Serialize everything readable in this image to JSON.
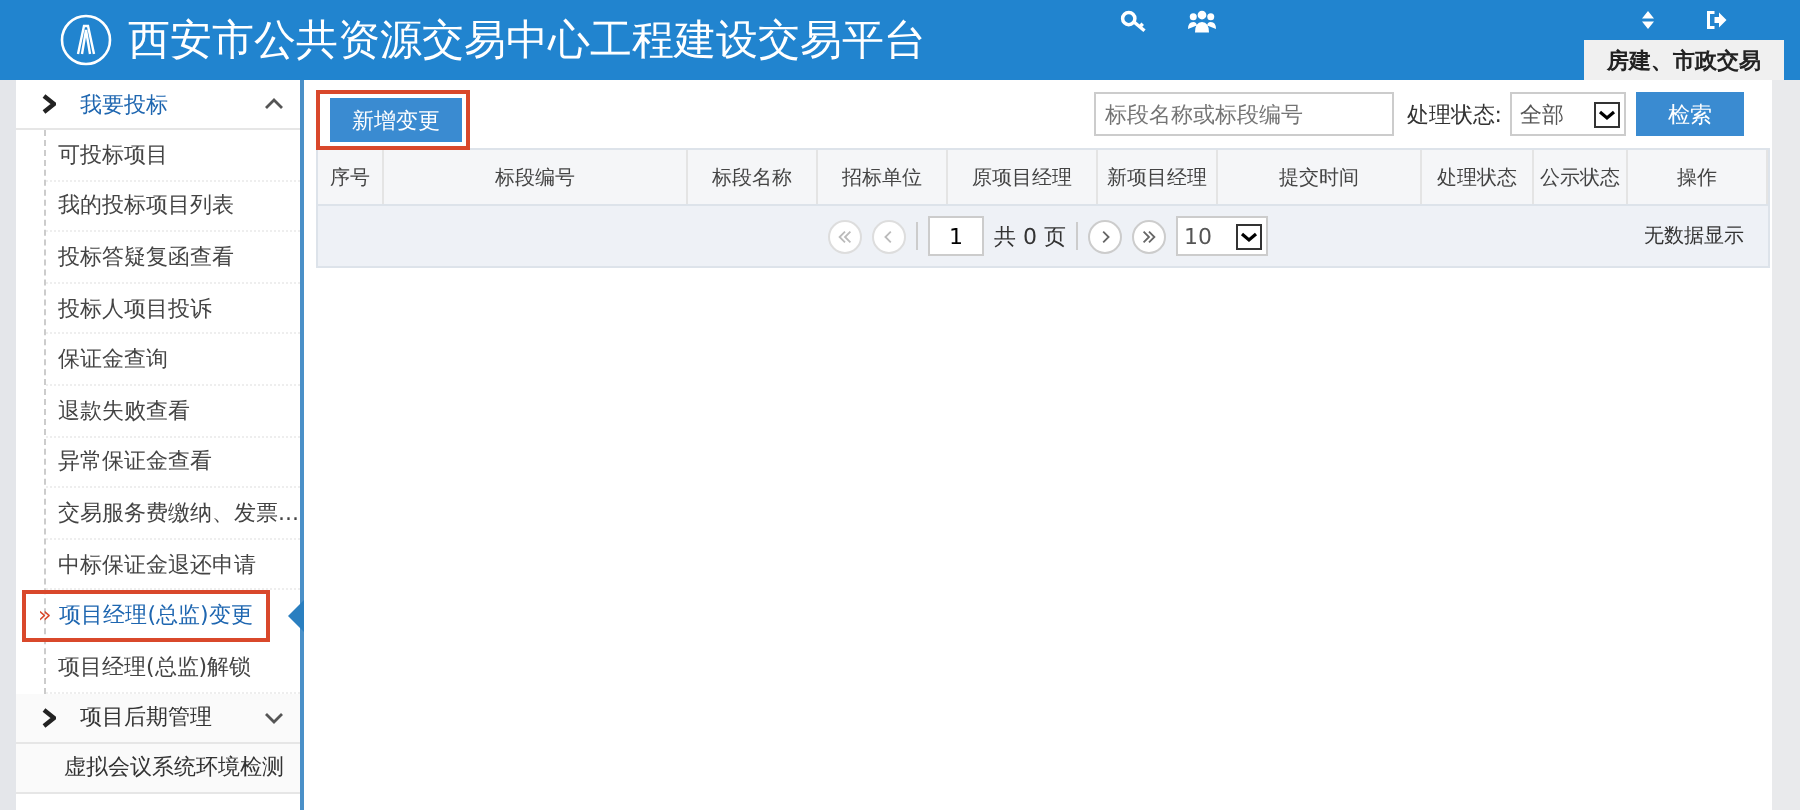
{
  "header": {
    "title": "西安市公共资源交易中心工程建设交易平台",
    "tab": {
      "label": "房建、市政交易",
      "selected": true
    }
  },
  "sidebar": {
    "selected_marker": "»",
    "groups": [
      {
        "label": "我要投标",
        "expanded": true,
        "items": [
          {
            "label": "可投标项目",
            "selected": false,
            "highlighted": false
          },
          {
            "label": "我的投标项目列表",
            "selected": false,
            "highlighted": false
          },
          {
            "label": "投标答疑复函查看",
            "selected": false,
            "highlighted": false
          },
          {
            "label": "投标人项目投诉",
            "selected": false,
            "highlighted": false
          },
          {
            "label": "保证金查询",
            "selected": false,
            "highlighted": false
          },
          {
            "label": "退款失败查看",
            "selected": false,
            "highlighted": false
          },
          {
            "label": "异常保证金查看",
            "selected": false,
            "highlighted": false
          },
          {
            "label": "交易服务费缴纳、发票...",
            "selected": false,
            "highlighted": false
          },
          {
            "label": "中标保证金退还申请",
            "selected": false,
            "highlighted": false
          },
          {
            "label": "项目经理(总监)变更",
            "selected": true,
            "highlighted": true
          },
          {
            "label": "项目经理(总监)解锁",
            "selected": false,
            "highlighted": false
          }
        ]
      },
      {
        "label": "项目后期管理",
        "expanded": false
      },
      {
        "label": "虚拟会议系统环境检测"
      }
    ]
  },
  "toolbar": {
    "add_button": {
      "label": "新增变更",
      "highlighted": true
    },
    "search": {
      "placeholder": "标段名称或标段编号"
    },
    "status_label": "处理状态:",
    "status_select": {
      "value": "全部"
    },
    "search_button": "检索"
  },
  "table": {
    "columns": [
      "序号",
      "标段编号",
      "标段名称",
      "招标单位",
      "原项目经理",
      "新项目经理",
      "提交时间",
      "处理状态",
      "公示状态",
      "操作"
    ]
  },
  "pager": {
    "page": "1",
    "total": "共 0 页",
    "page_size": "10",
    "empty_text": "无数据显示"
  }
}
